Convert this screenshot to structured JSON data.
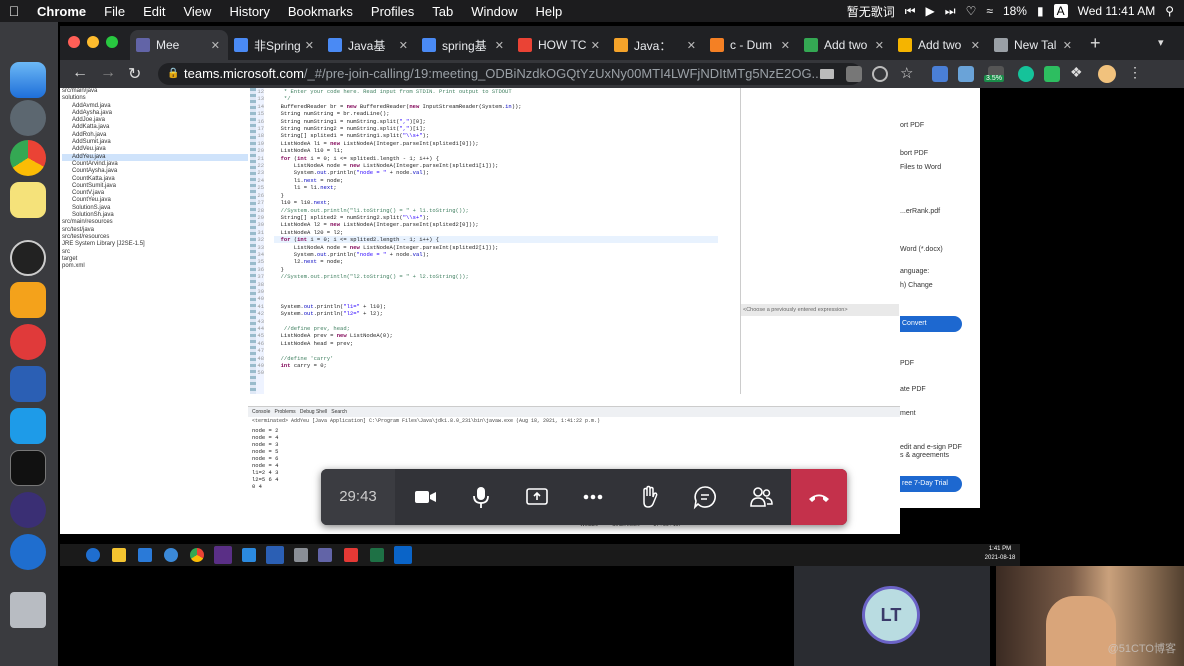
{
  "menubar": {
    "app": "Chrome",
    "items": [
      "File",
      "Edit",
      "View",
      "History",
      "Bookmarks",
      "Profiles",
      "Tab",
      "Window",
      "Help"
    ],
    "media_text": "暂无歌词",
    "battery": "18%",
    "input_method": "A",
    "clock": "Wed 11:41 AM"
  },
  "tabs": [
    {
      "label": "Mee",
      "color": "#6264a7"
    },
    {
      "label": "非Spring",
      "color": "#4a8af4"
    },
    {
      "label": "Java基",
      "color": "#4a8af4"
    },
    {
      "label": "spring基",
      "color": "#4a8af4"
    },
    {
      "label": "HOW TC",
      "color": "#ea4335"
    },
    {
      "label": "Java：",
      "color": "#f4a32a"
    },
    {
      "label": "c - Dum",
      "color": "#f48024"
    },
    {
      "label": "Add two",
      "color": "#34a853"
    },
    {
      "label": "Add two",
      "color": "#f5b400"
    },
    {
      "label": "New Tal",
      "color": "#9aa0a6"
    }
  ],
  "address": {
    "host": "teams.microsoft.com",
    "path": "/_#/pre-join-calling/19:meeting_ODBiNzdkOGQtYzUxNy00MTI4LWFjNDItMTg5NzE2OG..."
  },
  "extensions_badge": "3.5%",
  "package_tree": [
    "src/main/java",
    "solutions",
    "AddAvmd.java",
    "AddAysha.java",
    "AddJoe.java",
    "AddKatta.java",
    "AddRoh.java",
    "AddSumit.java",
    "AddVeu.java",
    "AddYeu.java",
    "CountArvind.java",
    "CountAysha.java",
    "CountKatta.java",
    "CountSumit.java",
    "CountV.java",
    "CountYeu.java",
    "SolutionS.java",
    "SolutionSh.java",
    "src/main/resources",
    "src/test/java",
    "src/test/resources",
    "JRE System Library [J2SE-1.5]",
    "src",
    "target",
    "pom.xml"
  ],
  "line_numbers": [
    "12",
    "13",
    "14",
    "15",
    "16",
    "17",
    "18",
    "19",
    "20",
    "21",
    "22",
    "23",
    "24",
    "25",
    "26",
    "27",
    "28",
    "29",
    "30",
    "31",
    "32",
    "33",
    "34",
    "35",
    "36",
    "37",
    "38",
    "39",
    "40",
    "41",
    "42",
    "43",
    "44",
    "45",
    "46",
    "47",
    "48",
    "49",
    "50"
  ],
  "console": {
    "tabs": [
      "Console",
      "Problems",
      "Debug Shell",
      "Search"
    ],
    "header": "<terminated> AddYeu [Java Application] C:\\Program Files\\Java\\jdk1.8.0_231\\bin\\javaw.exe (Aug 18, 2021, 1:41:22 p.m.)",
    "lines": [
      "node = 2",
      "node = 4",
      "node = 3",
      "node = 5",
      "node = 6",
      "node = 4",
      "l1=2 4 3",
      "l2=5 6 4",
      "0 4"
    ]
  },
  "expression_placeholder": "<Choose a previously entered expression>",
  "status_bar": [
    "Writable",
    "Smart Insert",
    "37 : 29 : 107"
  ],
  "word_panel": {
    "items": [
      "ort PDF",
      "bort PDF",
      "Files to Word",
      "...erRank.pdf",
      "Word (*.docx)",
      "anguage:",
      "h) Change",
      "Convert",
      "PDF",
      "ate PDF",
      "ment",
      "edit and e-sign PDF",
      "s & agreements",
      "ree 7-Day Trial"
    ]
  },
  "taskbar_clock": {
    "time": "1:41 PM",
    "date": "2021-08-18"
  },
  "meeting": {
    "timer": "29:43",
    "participant_initials": "LT",
    "watermark": "@51CTO博客"
  },
  "colors": {
    "teams_accent": "#6264a7",
    "hangup": "#c4314b",
    "convert_button": "#1d68d0"
  }
}
